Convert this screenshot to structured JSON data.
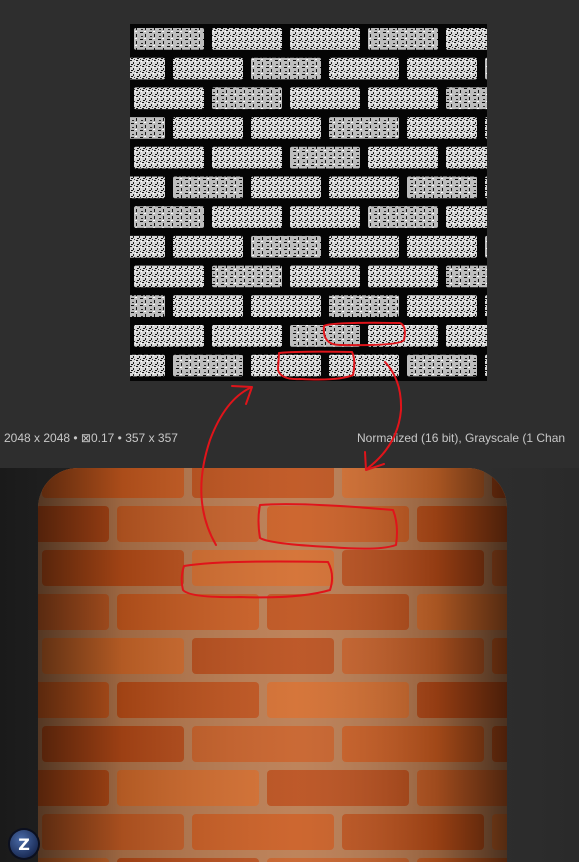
{
  "texture_panel": {
    "info_left": "2048 x 2048 • ⊠0.17 • 357 x 357",
    "info_right": "Normalized (16 bit), Grayscale (1 Chan"
  },
  "viewport": {
    "logo_letter": "Z"
  },
  "icons": {
    "logo": "zbrush-logo-icon"
  },
  "colors": {
    "annotation": "#e0141a",
    "brick": "#c4551c",
    "mortar": "#b07a55"
  }
}
